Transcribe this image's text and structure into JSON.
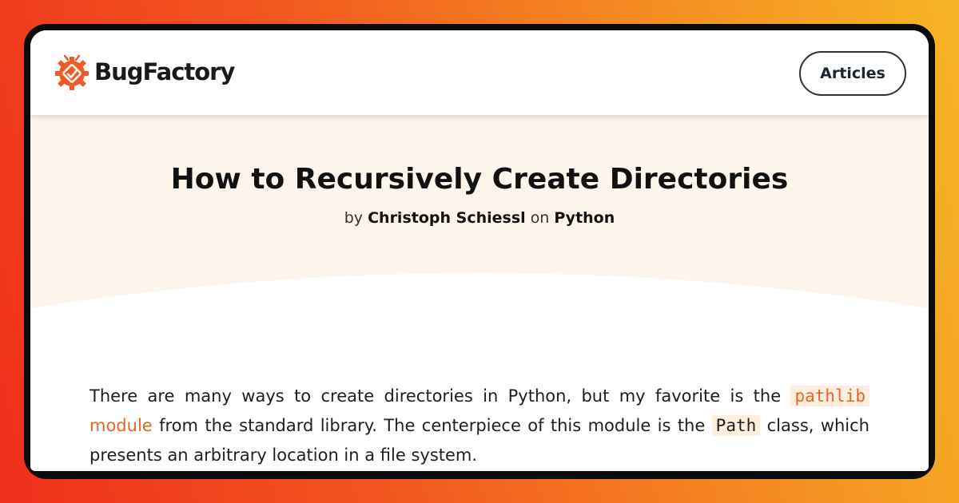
{
  "brand": {
    "name": "BugFactory",
    "accent": "#f05a28"
  },
  "nav": {
    "articles_label": "Articles"
  },
  "article": {
    "title": "How to Recursively Create Directories",
    "byline": {
      "by": "by",
      "author": "Christoph Schiessl",
      "on": "on",
      "category": "Python"
    },
    "body": {
      "seg1": "There are many ways to create directories in Python, but my favorite is the ",
      "link_code": "pathlib",
      "link_text": " module",
      "seg2": " from the standard library. The centerpiece of this module is the ",
      "code_path": "Path",
      "seg3": " class, which presents an arbitrary location in a file system."
    }
  },
  "colors": {
    "background_gradient": [
      "#ef2f1c",
      "#f7b526"
    ],
    "hero_background": "#fdf5ec",
    "link": "#e8642a",
    "code_background": "#fdeede"
  }
}
